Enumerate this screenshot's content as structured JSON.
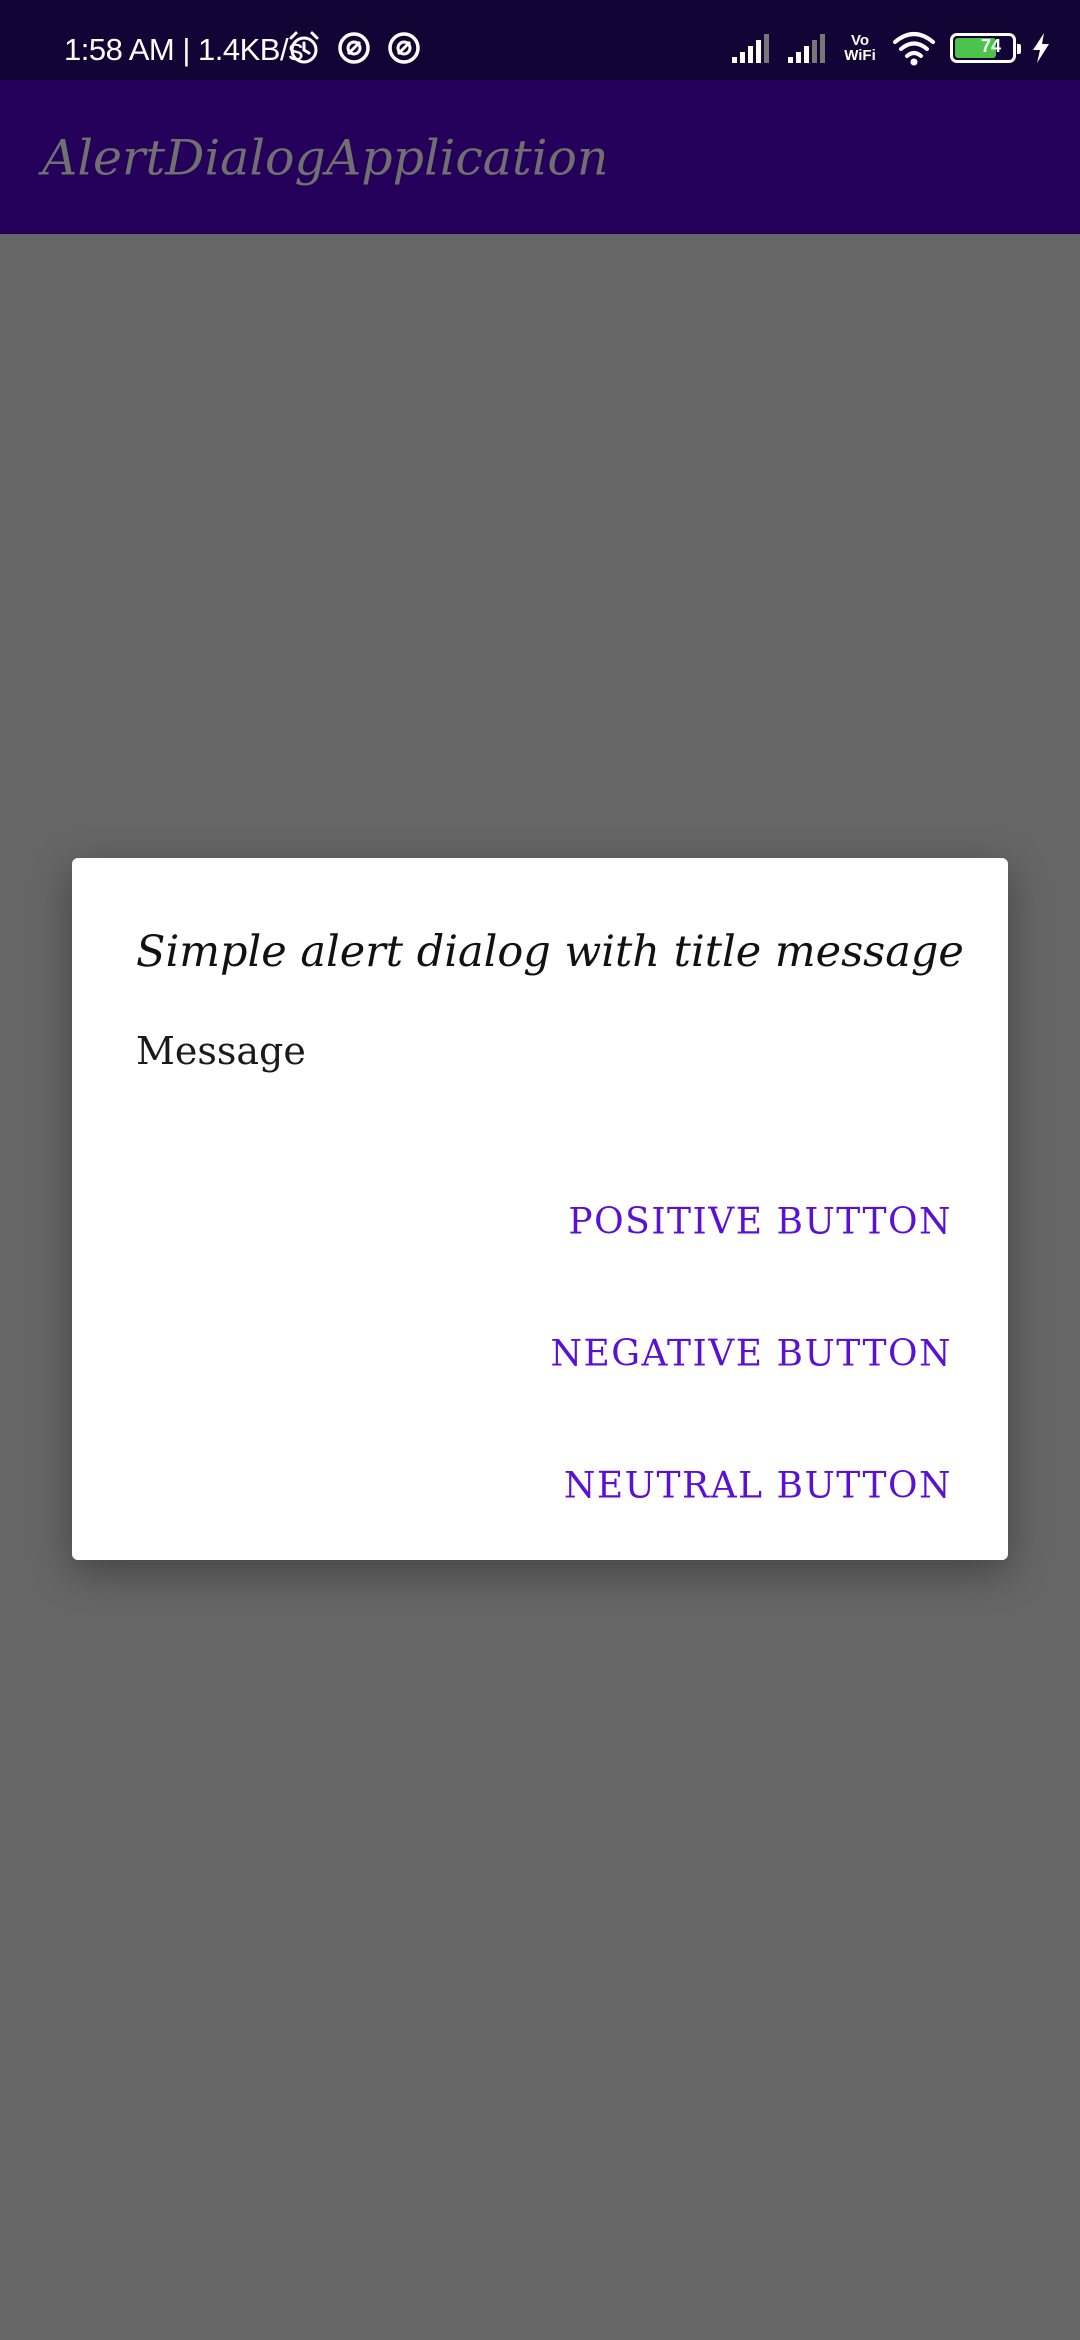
{
  "status_bar": {
    "time_speed": "1:58 AM | 1.4KB/s",
    "icons_left": [
      "alarm-icon",
      "vpn-icon",
      "vpn-icon"
    ],
    "vowifi_top": "Vo",
    "vowifi_bottom": "WiFi",
    "battery_level": "74",
    "battery_percent": 74
  },
  "app_bar": {
    "title": "AlertDialogApplication"
  },
  "dialog": {
    "title": "Simple alert dialog with title message",
    "message": "Message",
    "positive_label": "POSITIVE BUTTON",
    "negative_label": "NEGATIVE BUTTON",
    "neutral_label": "NEUTRAL BUTTON"
  },
  "colors": {
    "status_bar": "#120536",
    "app_bar": "#24005a",
    "scrim": "#666666",
    "button_text": "#5b10d6",
    "battery_fill": "#4cc44c"
  }
}
